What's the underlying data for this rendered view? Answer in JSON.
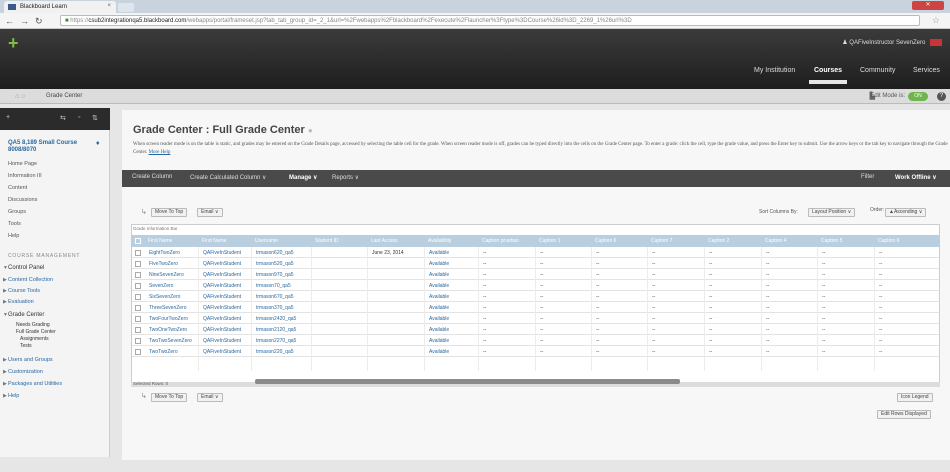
{
  "browser": {
    "tab_title": "Blackboard Learn",
    "tab_close": "×",
    "url_scheme": "https://",
    "url_host": "csub2integrationqa5.blackboard.com",
    "url_path": "/webapps/portal/frameset.jsp?tab_tab_group_id=_2_1&url=%2Fwebapps%2Fblackboard%2Fexecute%2Flauncher%3Ftype%3DCourse%26id%3D_2269_1%26url%3D"
  },
  "header": {
    "user": "QAFiveInstructor SevenZero",
    "nav": [
      "My Institution",
      "Courses",
      "Community",
      "Services"
    ],
    "active_nav": "Courses"
  },
  "breadcrumb": {
    "current": "Grade Center",
    "edit_mode_label": "Edit Mode is:",
    "edit_mode_value": "ON"
  },
  "left_menu": {
    "course": "QA5 8,189 Small Course 8008/8070",
    "items": [
      "Home Page",
      "Information III",
      "Content",
      "Discussions",
      "Groups",
      "Tools",
      "Help"
    ],
    "management_heading": "COURSE MANAGEMENT",
    "control_panel": "Control Panel",
    "cp_items": [
      "Content Collection",
      "Course Tools",
      "Evaluation"
    ],
    "grade_center": "Grade Center",
    "gc_items": [
      "Needs Grading",
      "Full Grade Center"
    ],
    "gc_sub_items": [
      "Assignments",
      "Tests"
    ],
    "bottom_items": [
      "Users and Groups",
      "Customization",
      "Packages and Utilities",
      "Help"
    ]
  },
  "page": {
    "title": "Grade Center : Full Grade Center",
    "description": "When screen reader mode is on the table is static, and grades may be entered on the Grade Details page, accessed by selecting the table cell for the grade. When screen reader mode is off, grades can be typed directly into the cells on the Grade Center page. To enter a grade: click the cell, type the grade value, and press the Enter key to submit. Use the arrow keys or the tab key to navigate through the Grade Center.",
    "more_help": "More Help"
  },
  "action_bar": {
    "items": [
      "Create Column",
      "Create Calculated Column ∨",
      "Manage ∨",
      "Reports ∨"
    ],
    "filter": "Filter",
    "work_offline": "Work Offline ∨"
  },
  "grid_controls": {
    "move_to_top": "Move To Top",
    "email": "Email ∨",
    "sort_label": "Sort Columns By:",
    "sort_value": "Layout Position ∨",
    "order_label": "Order:",
    "order_value": "▲Ascending ∨",
    "info_bar": "Grade Information Bar",
    "selected_rows": "Selected Rows: 0",
    "icon_legend": "Icon Legend",
    "edit_rows": "Edit Rows Displayed"
  },
  "columns": [
    "First Name",
    "First Name",
    "Username",
    "Student ID",
    "Last Access",
    "Availability",
    "Caption pruebas",
    "Caption 1",
    "Caption 6",
    "Caption 7",
    "Caption 2",
    "Caption 4",
    "Caption 5",
    "Caption 6"
  ],
  "rows": [
    [
      "EightTwoZero",
      "QAFiveInStudent",
      "trmason620_qa5",
      "",
      "June 23, 2014",
      "Available"
    ],
    [
      "FiveTwoZero",
      "QAFiveInStudent",
      "trmason520_qa5",
      "",
      "",
      "Available"
    ],
    [
      "NineSevenZero",
      "QAFiveInStudent",
      "trmason970_qa5",
      "",
      "",
      "Available"
    ],
    [
      "SevenZero",
      "QAFiveInStudent",
      "trmason70_qa5",
      "",
      "",
      "Available"
    ],
    [
      "SixSevenZero",
      "QAFiveInStudent",
      "trmason670_qa5",
      "",
      "",
      "Available"
    ],
    [
      "ThreeSevenZero",
      "QAFiveInStudent",
      "trmason370_qa5",
      "",
      "",
      "Available"
    ],
    [
      "TwoFourTwoZero",
      "QAFiveInStudent",
      "trmason2420_qa5",
      "",
      "",
      "Available"
    ],
    [
      "TwoOneTwoZero",
      "QAFiveInStudent",
      "trmason2120_qa5",
      "",
      "",
      "Available"
    ],
    [
      "TwoTwoSevenZero",
      "QAFiveInStudent",
      "trmason2270_qa5",
      "",
      "",
      "Available"
    ],
    [
      "TwoTwoZero",
      "QAFiveInStudent",
      "trmason220_qa5",
      "",
      "",
      "Available"
    ]
  ],
  "empty_cell": "--",
  "colors": {
    "header_dark": "#2b2b2b",
    "grid_header": "#b9cfe0",
    "link": "#29689f",
    "accent_green": "#7fbf3f"
  }
}
